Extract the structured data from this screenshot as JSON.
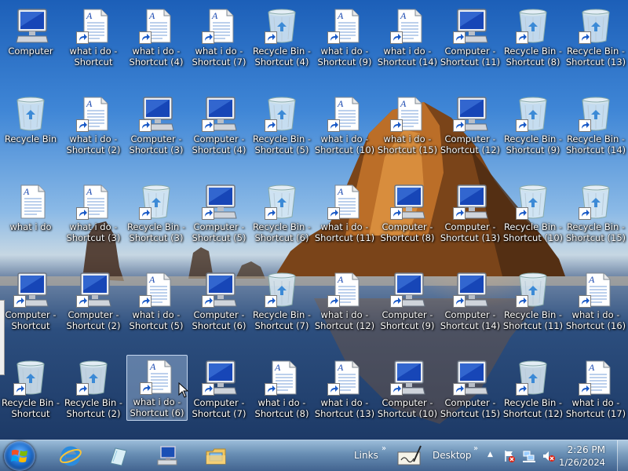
{
  "desktop": {
    "icons": [
      {
        "label": "Computer",
        "type": "computer",
        "shortcut": false,
        "col": 0,
        "row": 0
      },
      {
        "label": "what i do - Shortcut",
        "type": "document",
        "shortcut": true,
        "col": 1,
        "row": 0
      },
      {
        "label": "what i do - Shortcut (4)",
        "type": "document",
        "shortcut": true,
        "col": 2,
        "row": 0
      },
      {
        "label": "what i do - Shortcut (7)",
        "type": "document",
        "shortcut": true,
        "col": 3,
        "row": 0
      },
      {
        "label": "Recycle Bin - Shortcut (4)",
        "type": "recycle",
        "shortcut": true,
        "col": 4,
        "row": 0
      },
      {
        "label": "what i do - Shortcut (9)",
        "type": "document",
        "shortcut": true,
        "col": 5,
        "row": 0
      },
      {
        "label": "what i do - Shortcut (14)",
        "type": "document",
        "shortcut": true,
        "col": 6,
        "row": 0
      },
      {
        "label": "Computer - Shortcut (11)",
        "type": "computer",
        "shortcut": true,
        "col": 7,
        "row": 0
      },
      {
        "label": "Recycle Bin - Shortcut (8)",
        "type": "recycle",
        "shortcut": true,
        "col": 8,
        "row": 0
      },
      {
        "label": "Recycle Bin - Shortcut (13)",
        "type": "recycle",
        "shortcut": true,
        "col": 9,
        "row": 0
      },
      {
        "label": "Recycle Bin",
        "type": "recycle",
        "shortcut": false,
        "col": 0,
        "row": 1
      },
      {
        "label": "what i do - Shortcut (2)",
        "type": "document",
        "shortcut": true,
        "col": 1,
        "row": 1
      },
      {
        "label": "Computer - Shortcut (3)",
        "type": "computer",
        "shortcut": true,
        "col": 2,
        "row": 1
      },
      {
        "label": "Computer - Shortcut (4)",
        "type": "computer",
        "shortcut": true,
        "col": 3,
        "row": 1
      },
      {
        "label": "Recycle Bin - Shortcut (5)",
        "type": "recycle",
        "shortcut": true,
        "col": 4,
        "row": 1
      },
      {
        "label": "what i do - Shortcut (10)",
        "type": "document",
        "shortcut": true,
        "col": 5,
        "row": 1
      },
      {
        "label": "what i do - Shortcut (15)",
        "type": "document",
        "shortcut": true,
        "col": 6,
        "row": 1
      },
      {
        "label": "Computer - Shortcut (12)",
        "type": "computer",
        "shortcut": true,
        "col": 7,
        "row": 1
      },
      {
        "label": "Recycle Bin - Shortcut (9)",
        "type": "recycle",
        "shortcut": true,
        "col": 8,
        "row": 1
      },
      {
        "label": "Recycle Bin - Shortcut (14)",
        "type": "recycle",
        "shortcut": true,
        "col": 9,
        "row": 1
      },
      {
        "label": "what i do",
        "type": "document",
        "shortcut": false,
        "col": 0,
        "row": 2
      },
      {
        "label": "what i do - Shortcut (3)",
        "type": "document",
        "shortcut": true,
        "col": 1,
        "row": 2
      },
      {
        "label": "Recycle Bin - Shortcut (3)",
        "type": "recycle",
        "shortcut": true,
        "col": 2,
        "row": 2
      },
      {
        "label": "Computer - Shortcut (5)",
        "type": "computer",
        "shortcut": true,
        "col": 3,
        "row": 2
      },
      {
        "label": "Recycle Bin - Shortcut (6)",
        "type": "recycle",
        "shortcut": true,
        "col": 4,
        "row": 2
      },
      {
        "label": "what i do - Shortcut (11)",
        "type": "document",
        "shortcut": true,
        "col": 5,
        "row": 2
      },
      {
        "label": "Computer - Shortcut (8)",
        "type": "computer",
        "shortcut": true,
        "col": 6,
        "row": 2
      },
      {
        "label": "Computer - Shortcut (13)",
        "type": "computer",
        "shortcut": true,
        "col": 7,
        "row": 2
      },
      {
        "label": "Recycle Bin - Shortcut (10)",
        "type": "recycle",
        "shortcut": true,
        "col": 8,
        "row": 2
      },
      {
        "label": "Recycle Bin - Shortcut (15)",
        "type": "recycle",
        "shortcut": true,
        "col": 9,
        "row": 2
      },
      {
        "label": "Computer - Shortcut",
        "type": "computer",
        "shortcut": true,
        "col": 0,
        "row": 3
      },
      {
        "label": "Computer - Shortcut (2)",
        "type": "computer",
        "shortcut": true,
        "col": 1,
        "row": 3
      },
      {
        "label": "what i do - Shortcut (5)",
        "type": "document",
        "shortcut": true,
        "col": 2,
        "row": 3
      },
      {
        "label": "Computer - Shortcut (6)",
        "type": "computer",
        "shortcut": true,
        "col": 3,
        "row": 3
      },
      {
        "label": "Recycle Bin - Shortcut (7)",
        "type": "recycle",
        "shortcut": true,
        "col": 4,
        "row": 3
      },
      {
        "label": "what i do - Shortcut (12)",
        "type": "document",
        "shortcut": true,
        "col": 5,
        "row": 3
      },
      {
        "label": "Computer - Shortcut (9)",
        "type": "computer",
        "shortcut": true,
        "col": 6,
        "row": 3
      },
      {
        "label": "Computer - Shortcut (14)",
        "type": "computer",
        "shortcut": true,
        "col": 7,
        "row": 3
      },
      {
        "label": "Recycle Bin - Shortcut (11)",
        "type": "recycle",
        "shortcut": true,
        "col": 8,
        "row": 3
      },
      {
        "label": "what i do - Shortcut (16)",
        "type": "document",
        "shortcut": true,
        "col": 9,
        "row": 3
      },
      {
        "label": "Recycle Bin - Shortcut",
        "type": "recycle",
        "shortcut": true,
        "col": 0,
        "row": 4
      },
      {
        "label": "Recycle Bin - Shortcut (2)",
        "type": "recycle",
        "shortcut": true,
        "col": 1,
        "row": 4
      },
      {
        "label": "what i do - Shortcut (6)",
        "type": "document",
        "shortcut": true,
        "col": 2,
        "row": 4,
        "selected": true
      },
      {
        "label": "Computer - Shortcut (7)",
        "type": "computer",
        "shortcut": true,
        "col": 3,
        "row": 4
      },
      {
        "label": "what i do - Shortcut (8)",
        "type": "document",
        "shortcut": true,
        "col": 4,
        "row": 4
      },
      {
        "label": "what i do - Shortcut (13)",
        "type": "document",
        "shortcut": true,
        "col": 5,
        "row": 4
      },
      {
        "label": "Computer - Shortcut (10)",
        "type": "computer",
        "shortcut": true,
        "col": 6,
        "row": 4
      },
      {
        "label": "Computer - Shortcut (15)",
        "type": "computer",
        "shortcut": true,
        "col": 7,
        "row": 4
      },
      {
        "label": "Recycle Bin - Shortcut (12)",
        "type": "recycle",
        "shortcut": true,
        "col": 8,
        "row": 4
      },
      {
        "label": "what i do - Shortcut (17)",
        "type": "document",
        "shortcut": true,
        "col": 9,
        "row": 4
      }
    ]
  },
  "taskbar": {
    "start_icon": "windows-logo-icon",
    "pinned": [
      {
        "name": "internet-explorer",
        "icon": "internet-explorer-icon"
      },
      {
        "name": "notepad",
        "icon": "notepad-icon"
      },
      {
        "name": "computer",
        "icon": "computer-icon"
      },
      {
        "name": "file-explorer",
        "icon": "folder-icon"
      }
    ],
    "links_label": "Links",
    "desktop_label": "Desktop",
    "chevron": "»",
    "tray_arrow": "▲",
    "time": "2:26 PM",
    "date": "1/26/2024",
    "tray_icons": [
      "action-center-flag-icon",
      "network-icon",
      "volume-muted-icon"
    ]
  },
  "colors": {
    "accent": "#1f6fcf",
    "taskbar_top": "#96b9d7",
    "taskbar_bottom": "#3c5f8c",
    "selection": "#c8e1ff"
  }
}
